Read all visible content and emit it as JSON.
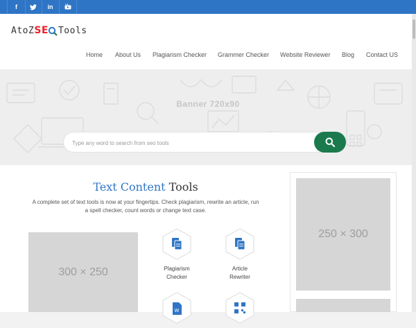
{
  "topbar": {
    "social": [
      {
        "name": "facebook-icon",
        "glyph": "f"
      },
      {
        "name": "twitter-icon",
        "glyph": "t"
      },
      {
        "name": "linkedin-icon",
        "glyph": "in"
      },
      {
        "name": "youtube-icon",
        "glyph": "▶"
      }
    ]
  },
  "logo": {
    "prefix": "AtoZ",
    "seo": "SE",
    "suffix": "Tools"
  },
  "nav": [
    "Home",
    "About Us",
    "Plagiarism Checker",
    "Grammer Checker",
    "Website Reviewer",
    "Blog",
    "Contact US"
  ],
  "hero": {
    "banner_text": "Banner  720x90",
    "search_placeholder": "Type any word to search from seo tools"
  },
  "section": {
    "title_highlight": "Text Content",
    "title_rest": " Tools",
    "description": "A complete set of text tools is now at your fingertips. Check plagiarism, rewrite an article, run a spell checker, count words or change text case."
  },
  "ads": {
    "main": "300 × 250",
    "sidebar": "250 × 300"
  },
  "tools": [
    {
      "label_line1": "Plagiarism",
      "label_line2": "Checker"
    },
    {
      "label_line1": "Article",
      "label_line2": "Rewriter"
    }
  ],
  "colors": {
    "brand": "#2f75c6",
    "accent": "#e8242d",
    "search_button": "#1b7a4d"
  }
}
